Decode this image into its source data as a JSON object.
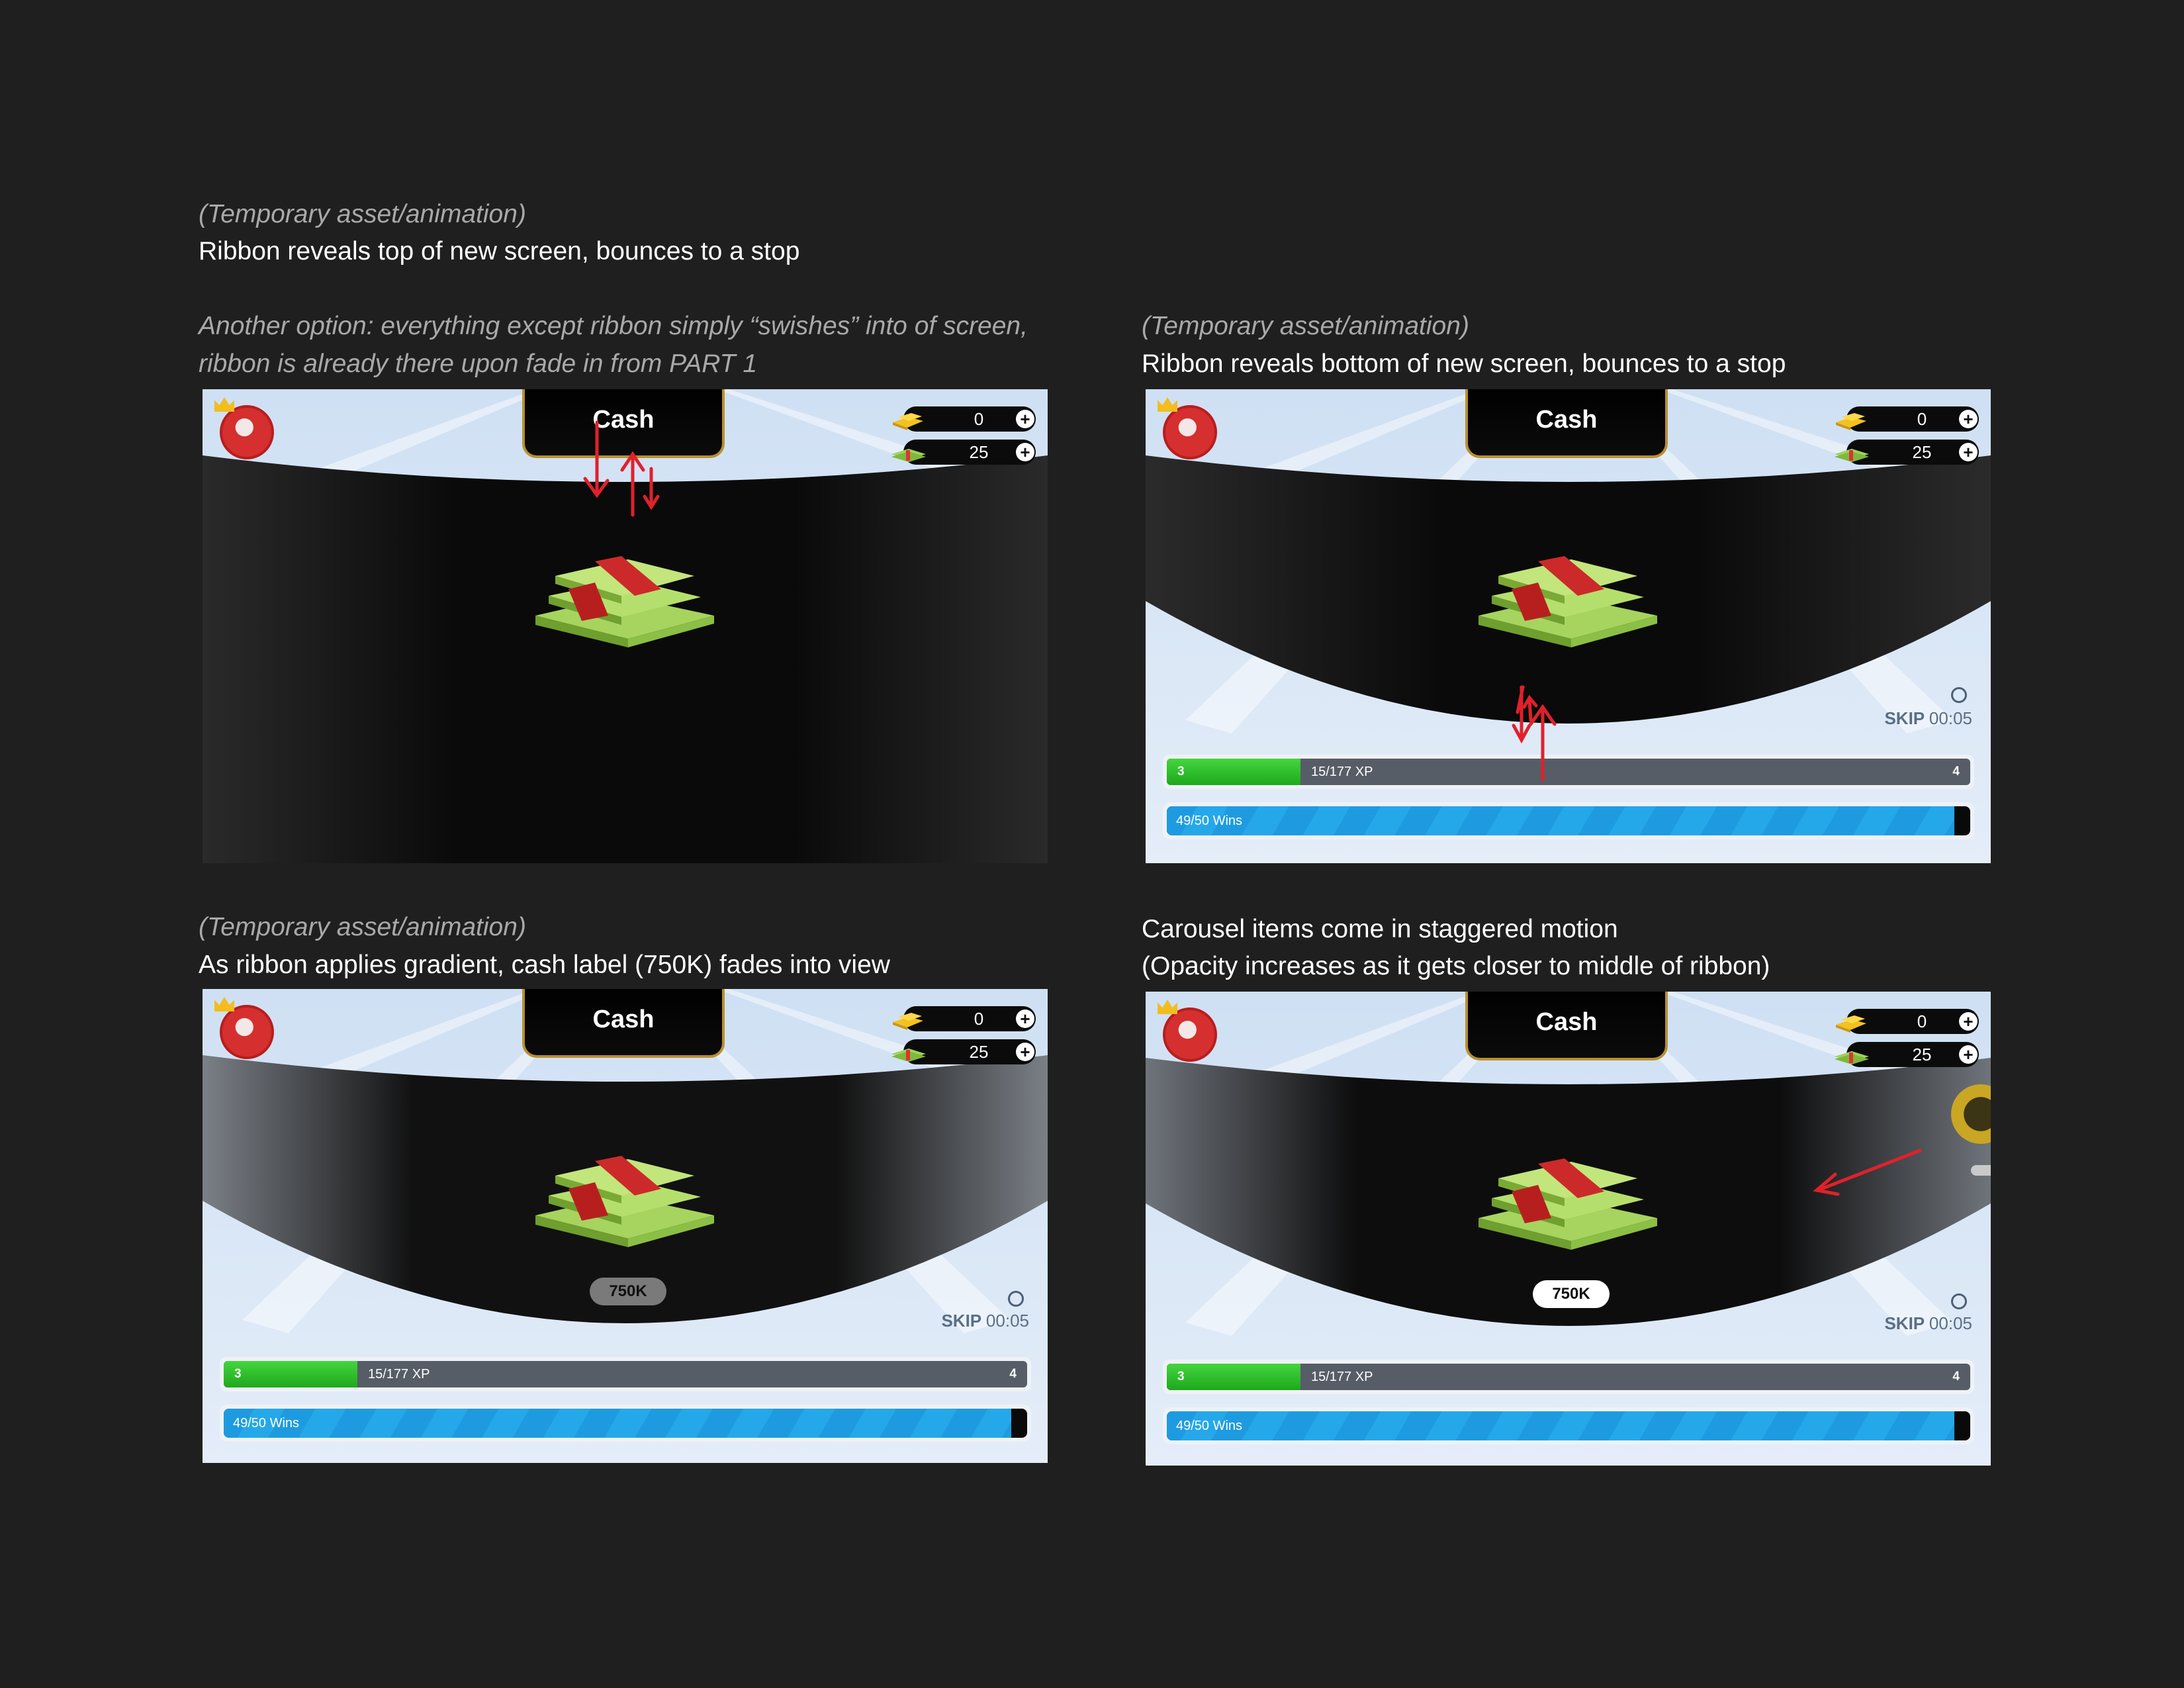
{
  "captions": {
    "p1_note": "(Temporary asset/animation)",
    "p1_line": "Ribbon reveals top of new screen, bounces to a stop",
    "p1_alt1": "Another option: everything except ribbon simply “swishes” into of screen,",
    "p1_alt2": "ribbon is already there upon fade in from PART 1",
    "p2_note": "(Temporary asset/animation)",
    "p2_line": "Ribbon reveals bottom of new screen, bounces to a stop",
    "p3_note": "(Temporary asset/animation)",
    "p3_line": "As ribbon applies gradient, cash label (750K) fades into view",
    "p4_line1": "Carousel items come in staggered motion",
    "p4_line2": "(Opacity increases as it gets closer to middle of ribbon)"
  },
  "screen": {
    "title": "Cash",
    "gold_value": "0",
    "cash_value": "25",
    "plus_label": "+",
    "reward_label": "750K",
    "skip_label": "SKIP",
    "skip_time": "00:05",
    "level_current": "3",
    "level_next": "4",
    "xp_text": "15/177 XP",
    "wins_text": "49/50 Wins",
    "wins_progress": 0.98
  },
  "colors": {
    "background": "#1f1f1f",
    "annotation_arrow": "#e0212b",
    "tab_border": "#b9902f",
    "xp_fill": "#2fc12b",
    "wins_fill": "#1e9be0"
  },
  "icons": [
    "avatar-icon",
    "crown-icon",
    "gold-bars-icon",
    "cash-stack-icon",
    "plus-icon",
    "timer-icon",
    "money-stack-icon"
  ]
}
